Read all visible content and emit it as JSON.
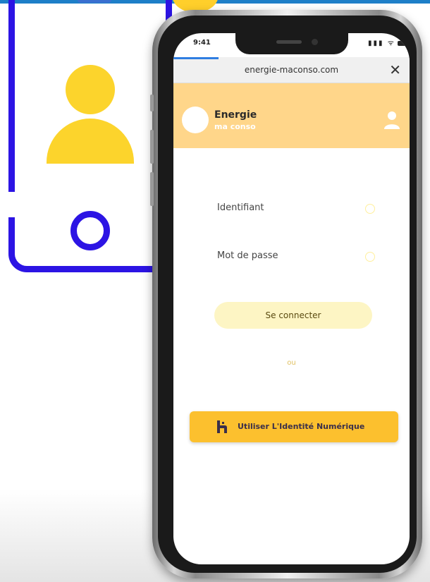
{
  "status_bar": {
    "time": "9:41",
    "signal": "▮▮▮ ᯤ"
  },
  "browser": {
    "url": "energie-maconso.com",
    "close_glyph": "✕"
  },
  "header": {
    "brand_name": "Energie",
    "brand_tagline": "ma conso",
    "user_icon": "user-icon"
  },
  "login": {
    "identifiant_label": "Identifiant",
    "password_label": "Mot de passe",
    "connect_label": "Se connecter",
    "or_label": "ou"
  },
  "identity": {
    "button_label": "Utiliser L'Identité Numérique",
    "logo_icon": "identite-numerique-logo-icon"
  },
  "colors": {
    "header_bg": "#ffd68a",
    "accent_yellow": "#fcc02e",
    "illustration_blue": "#2c14e4",
    "illustration_yellow": "#fcd42c"
  }
}
